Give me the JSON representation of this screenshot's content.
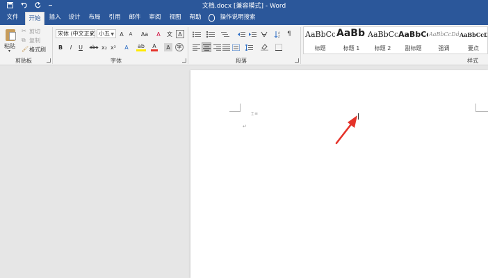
{
  "title_bar": {
    "doc_title": "文档.docx [兼容模式] - Word",
    "icons": [
      "save-icon",
      "undo-icon",
      "redo-icon",
      "customize-qat-icon"
    ]
  },
  "menu": {
    "tabs": [
      "文件",
      "开始",
      "插入",
      "设计",
      "布局",
      "引用",
      "邮件",
      "审阅",
      "视图",
      "帮助"
    ],
    "active_tab": "开始",
    "tell_me": "操作说明搜索"
  },
  "clipboard": {
    "paste": "粘贴",
    "cut": "剪切",
    "copy": "复制",
    "format_painter": "格式刷",
    "group_label": "剪贴板"
  },
  "font": {
    "font_name": "宋体 (中文正文",
    "font_size": "小五",
    "grow": "A",
    "shrink": "A",
    "case": "Aa",
    "clear": "A",
    "phonetic": "文",
    "enclose": "A",
    "bold": "B",
    "italic": "I",
    "underline": "U",
    "strikethrough": "abc",
    "subscript": "x₂",
    "superscript": "x²",
    "text_effects": "A",
    "highlight": "ab",
    "font_color": "A",
    "char_shading": "A",
    "enclose_char": "字",
    "group_label": "字体"
  },
  "paragraph": {
    "group_label": "段落"
  },
  "styles": {
    "items": [
      {
        "sample": "AaBbCcDd",
        "name": "标题"
      },
      {
        "sample": "AaBb",
        "name": "标题 1"
      },
      {
        "sample": "AaBbCc",
        "name": "标题 2"
      },
      {
        "sample": "AaBbCc",
        "name": "副标题"
      },
      {
        "sample": "AaBbCcDd",
        "name": "强调"
      },
      {
        "sample": "AaBbCcDd",
        "name": "要点"
      }
    ],
    "group_label": "样式"
  },
  "colors": {
    "brand": "#2b579a",
    "ribbon": "#f3f3f3",
    "canvas": "#e6e6e6",
    "arrow": "#e5332a"
  }
}
